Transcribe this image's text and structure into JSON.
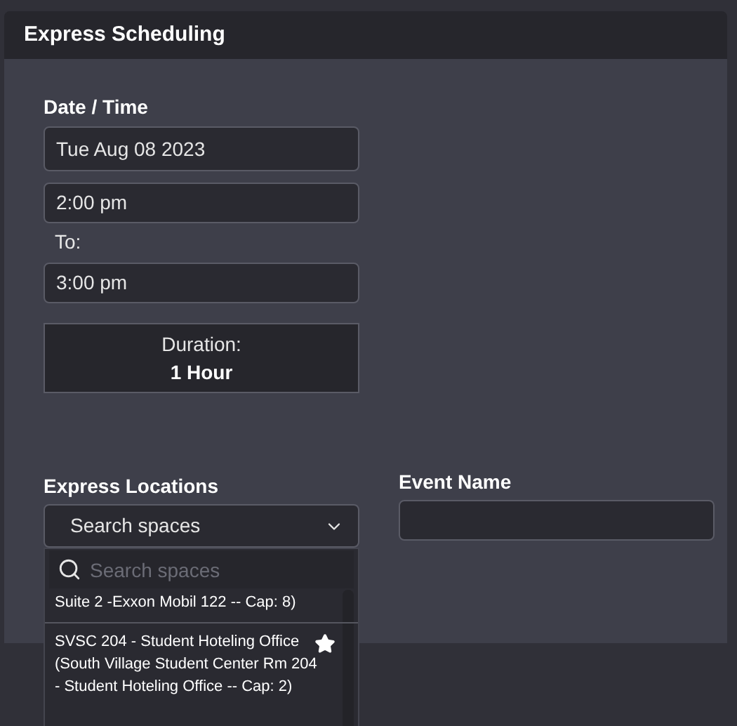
{
  "panel": {
    "title": "Express Scheduling"
  },
  "date_time": {
    "label": "Date / Time",
    "date": "Tue Aug 08 2023",
    "start": "2:00 pm",
    "to_label": "To:",
    "end": "3:00 pm"
  },
  "duration": {
    "label": "Duration:",
    "value": "1 Hour"
  },
  "express_locations": {
    "label": "Express Locations",
    "select": "Search spaces",
    "search": {
      "placeholder": "Search spaces"
    },
    "items": [
      {
        "text": "Suite 2 -Exxon Mobil 122 -- Cap: 8)",
        "starred": false
      },
      {
        "text": "SVSC 204 - Student Hoteling Office (South Village Student Center Rm 204 - Student Hoteling Office -- Cap: 2)",
        "starred": true
      }
    ]
  },
  "event_name": {
    "label": "Event Name"
  }
}
